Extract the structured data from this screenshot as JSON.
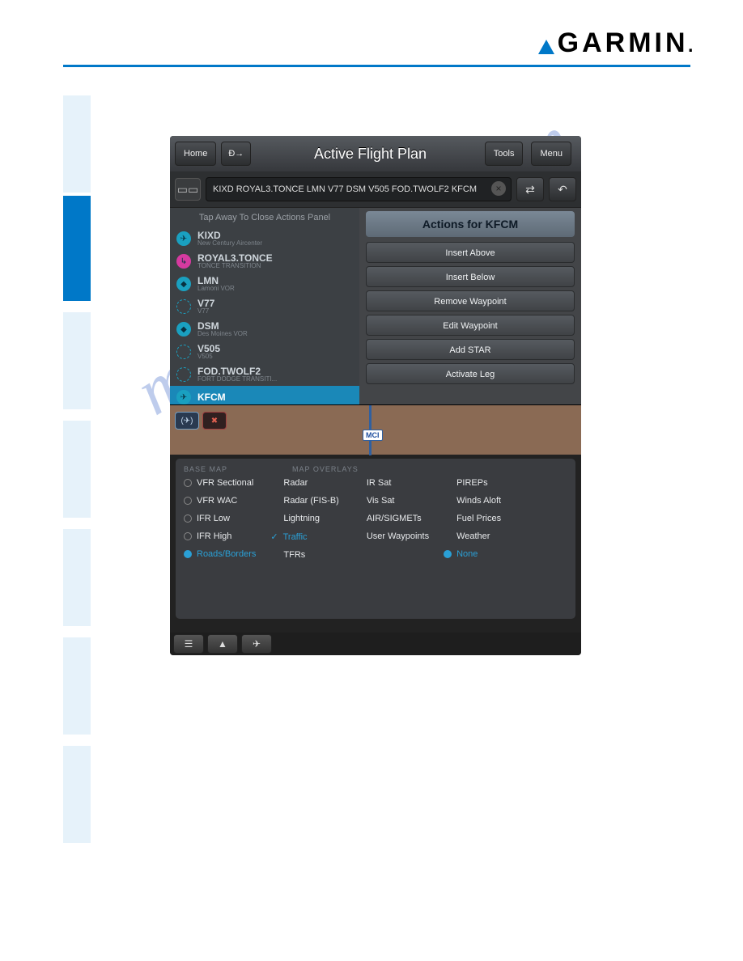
{
  "brand": {
    "name": "GARMIN"
  },
  "watermark": "manualshive.com",
  "titlebar": {
    "home": "Home",
    "title": "Active Flight Plan",
    "tools": "Tools",
    "menu": "Menu"
  },
  "route": {
    "text": "KIXD ROYAL3.TONCE LMN V77 DSM V505 FOD.TWOLF2 KFCM"
  },
  "fplist": {
    "hint": "Tap Away To Close Actions Panel",
    "items": [
      {
        "code": "KIXD",
        "desc": "New Century Aircenter",
        "icon": "airport"
      },
      {
        "code": "ROYAL3.TONCE",
        "desc": "TONCE TRANSITION",
        "icon": "sid"
      },
      {
        "code": "LMN",
        "desc": "Lamoni VOR",
        "icon": "vor"
      },
      {
        "code": "V77",
        "desc": "V77",
        "icon": "airway"
      },
      {
        "code": "DSM",
        "desc": "Des Moines VOR",
        "icon": "vor"
      },
      {
        "code": "V505",
        "desc": "V505",
        "icon": "airway"
      },
      {
        "code": "FOD.TWOLF2",
        "desc": "FORT DODGE TRANSITI...",
        "icon": "star"
      },
      {
        "code": "KFCM",
        "desc": "",
        "icon": "airport",
        "selected": true
      }
    ]
  },
  "actions": {
    "title": "Actions for KFCM",
    "buttons": [
      "Insert Above",
      "Insert Below",
      "Remove Waypoint",
      "Edit Waypoint",
      "Add STAR",
      "Activate Leg"
    ]
  },
  "map": {
    "label": "MCI"
  },
  "opts": {
    "head_base": "BASE MAP",
    "head_over": "MAP OVERLAYS",
    "col1": [
      {
        "label": "VFR Sectional"
      },
      {
        "label": "VFR WAC"
      },
      {
        "label": "IFR Low"
      },
      {
        "label": "IFR High"
      },
      {
        "label": "Roads/Borders",
        "selected": true
      }
    ],
    "col2": [
      {
        "label": "Radar"
      },
      {
        "label": "Radar (FIS-B)"
      },
      {
        "label": "Lightning"
      },
      {
        "label": "Traffic",
        "checked": true
      },
      {
        "label": "TFRs"
      }
    ],
    "col3": [
      {
        "label": "IR Sat"
      },
      {
        "label": "Vis Sat"
      },
      {
        "label": "AIR/SIGMETs"
      },
      {
        "label": "User Waypoints"
      }
    ],
    "col4": [
      {
        "label": "PIREPs"
      },
      {
        "label": "Winds Aloft"
      },
      {
        "label": "Fuel Prices"
      },
      {
        "label": "Weather"
      },
      {
        "label": "None",
        "selected": true
      }
    ]
  }
}
